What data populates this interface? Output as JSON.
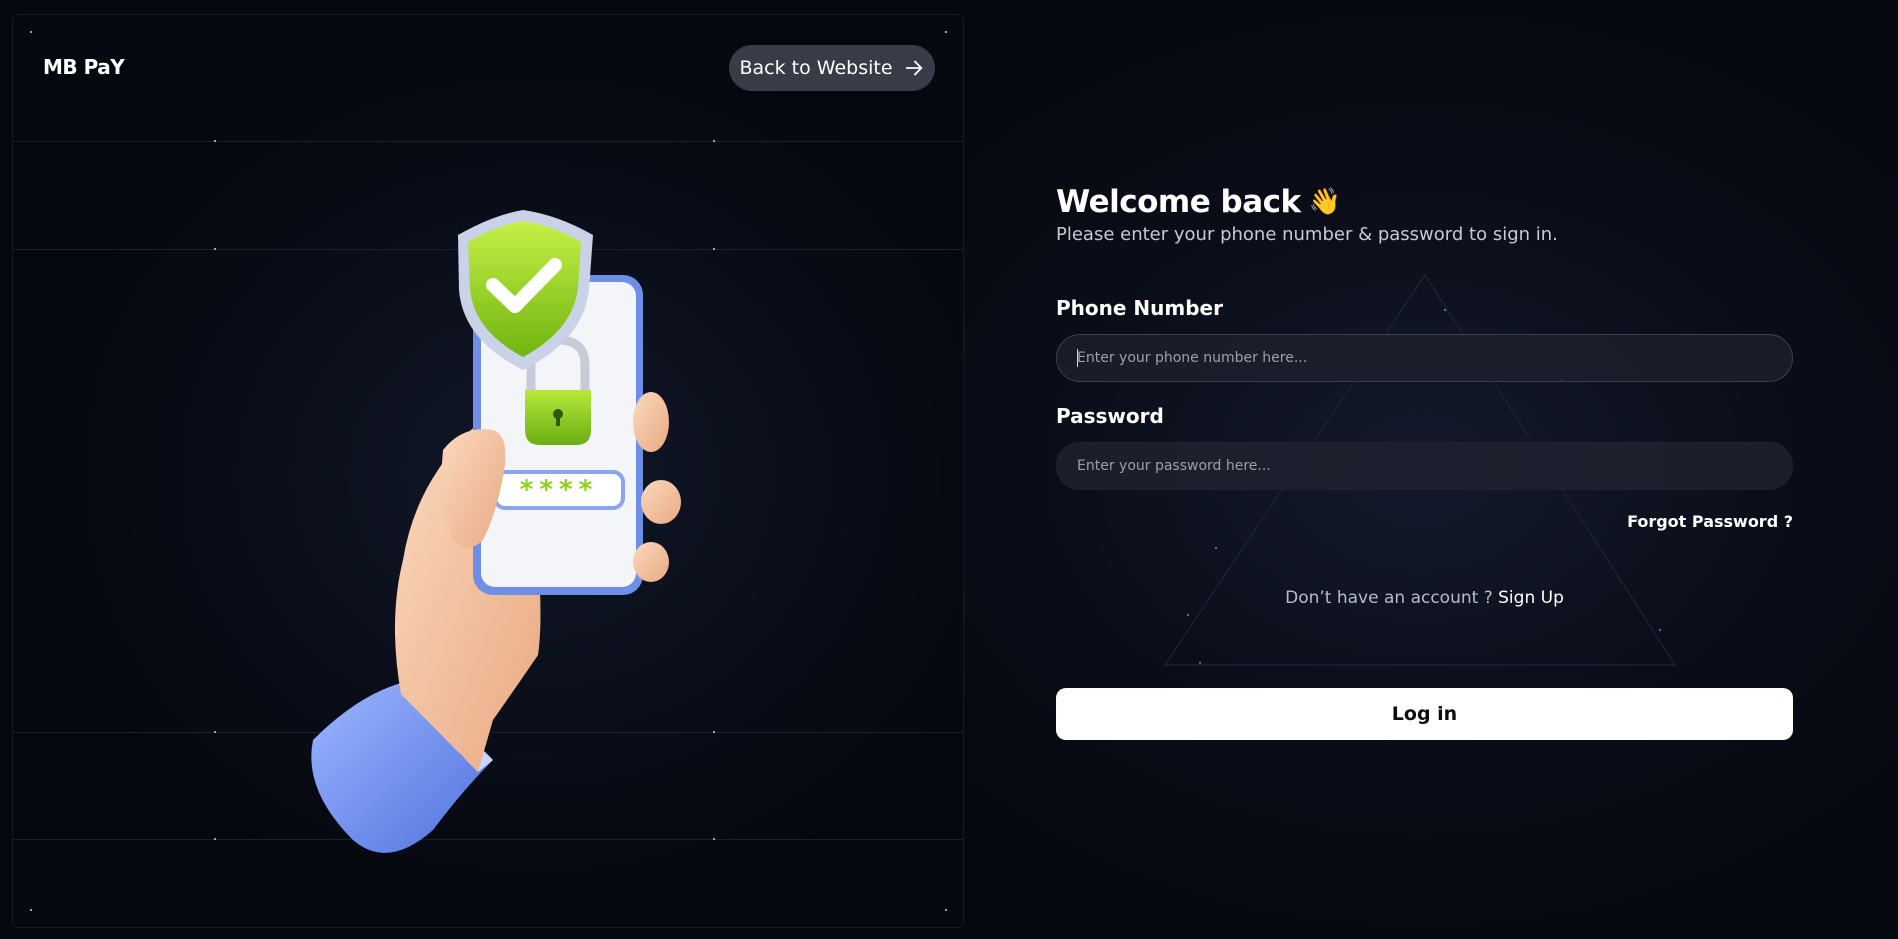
{
  "brand": {
    "name": "MB PaY"
  },
  "header": {
    "back_label": "Back to Website",
    "back_icon": "arrow-right-icon"
  },
  "illustration": {
    "description_icon": "hand-holding-phone-lock-icon"
  },
  "form": {
    "title": "Welcome back",
    "title_icon": "👋",
    "subtitle": "Please enter your phone number & password to sign in.",
    "phone_label": "Phone Number",
    "phone_placeholder": "Enter your phone number here...",
    "password_label": "Password",
    "password_placeholder": "Enter your password here...",
    "forgot_label": "Forgot Password ?",
    "signup_prompt": "Don’t have an account ?",
    "signup_link": "Sign Up",
    "login_label": "Log in"
  },
  "colors": {
    "background": "#06080f",
    "accent_green": "#8fd11d",
    "accent_blue": "#6f8fe6",
    "button_dark": "#393c48",
    "button_light": "#ffffff"
  }
}
